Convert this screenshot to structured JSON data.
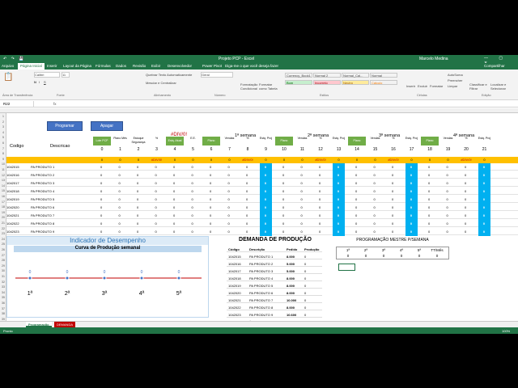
{
  "titlebar": {
    "quick_access": "↶ ↷ 💾",
    "title": "Projeto PCP - Excel",
    "user": "Marcelo Medina",
    "controls": "— ▢ ✕"
  },
  "tabs": [
    "Arquivo",
    "Página Inicial",
    "Inserir",
    "Layout da Página",
    "Fórmulas",
    "Dados",
    "Revisão",
    "Exibir",
    "Desenvolvedor",
    "Power Pivot",
    "Diga-me o que você deseja fazer"
  ],
  "share_label": "Compartilhar",
  "ribbon": {
    "font_name": "Calibri",
    "font_size": "11",
    "wrap_text": "Quebrar Texto Automaticamente",
    "merge": "Mesclar e Centralizar",
    "number_format": "Geral",
    "conditional": "Formatação Condicional",
    "format_table": "Formatar como Tabela",
    "styles": [
      {
        "label": "Currency_Book1",
        "bg": "#ffffff"
      },
      {
        "label": "Normal 2",
        "bg": "#ffffff"
      },
      {
        "label": "Normal_Cal...",
        "bg": "#ffffff"
      },
      {
        "label": "Normal",
        "bg": "#ffffff"
      },
      {
        "label": "Bom",
        "bg": "#c6efce"
      },
      {
        "label": "Incorreto",
        "bg": "#ffc7ce"
      },
      {
        "label": "Neutro",
        "bg": "#ffeb9c"
      },
      {
        "label": "Cálculo",
        "bg": "#f2f2f2"
      }
    ],
    "insert": "Inserir",
    "delete": "Excluir",
    "format": "Formatar",
    "autosum": "AutoSoma",
    "fill": "Preencher",
    "clear": "Limpar",
    "sort": "Classificar e Filtrar",
    "find": "Localizar e Selecionar",
    "groups": [
      "Área de Transferência",
      "Fonte",
      "Alinhamento",
      "Número",
      "Estilos",
      "Células",
      "Edição"
    ]
  },
  "formula_bar": {
    "name_box": "R22",
    "fx": "fx"
  },
  "buttons": {
    "programar": "Programar",
    "apagar": "Apagar"
  },
  "header": {
    "codigo": "Codigo",
    "descricao": "Descricao",
    "div_error": "#DIV/0!",
    "weeks": [
      "1ª semana",
      "2ª semana",
      "3ª semana",
      "4ª semana"
    ],
    "col_numbers": [
      "0",
      "1",
      "2",
      "3",
      "4",
      "5",
      "6",
      "7",
      "8",
      "9",
      "10",
      "11",
      "12",
      "13",
      "14",
      "15",
      "16",
      "17",
      "18",
      "19",
      "20",
      "21"
    ],
    "col_labels": [
      "Lote PCP",
      "Plano Mês",
      "Estoque Segurança",
      "%",
      "Estq. Atual",
      "E.E.",
      "Plano",
      "Vendas",
      "%",
      "Estq. Proj",
      "Plano",
      "Vendas",
      "%",
      "Estq. Proj",
      "Plano",
      "Vendas",
      "%",
      "Estq. Proj",
      "Plano",
      "Vendas",
      "%",
      "Estq. Proj"
    ],
    "orange_values": [
      "0",
      "0",
      "0",
      "#DIV/0!",
      "0",
      "0",
      "0",
      "0",
      "#DIV/0!",
      "0",
      "0",
      "0",
      "#DIV/0!",
      "0",
      "0",
      "0",
      "#DIV/0!",
      "0",
      "0",
      "0",
      "#DIV/0!",
      "0"
    ]
  },
  "rows": [
    {
      "code": "1042015",
      "desc": "PA PRODUTO 1"
    },
    {
      "code": "1042016",
      "desc": "PA PRODUTO 2"
    },
    {
      "code": "1042017",
      "desc": "PA PRODUTO 3"
    },
    {
      "code": "1042018",
      "desc": "PA PRODUTO 4"
    },
    {
      "code": "1042019",
      "desc": "PA PRODUTO 5"
    },
    {
      "code": "1042020",
      "desc": "PA PRODUTO 6"
    },
    {
      "code": "1042021",
      "desc": "PA PRODUTO 7"
    },
    {
      "code": "1042022",
      "desc": "PA PRODUTO 8"
    },
    {
      "code": "1042023",
      "desc": "PA PRODUTO 9"
    }
  ],
  "row_numbers": [
    "1",
    "2",
    "3",
    "4",
    "5",
    "6",
    "7",
    "8",
    "9",
    "10",
    "11",
    "12",
    "13",
    "14",
    "15",
    "16",
    "17",
    "18",
    "19",
    "20",
    "21",
    "22",
    "23",
    "24",
    "25",
    "26",
    "27",
    "28",
    "29",
    "30",
    "31",
    "32",
    "33",
    "34",
    "35",
    "36",
    "37",
    "38",
    "39"
  ],
  "chart": {
    "title": "Indicador de Desempenho",
    "subtitle": "Curva de Produção semanal"
  },
  "chart_data": {
    "type": "line",
    "title": "Curva de Produção semanal",
    "categories": [
      "1ª",
      "2ª",
      "3ª",
      "4ª",
      "5ª"
    ],
    "series": [
      {
        "values": [
          0,
          0,
          0,
          0,
          0
        ]
      }
    ],
    "data_labels": [
      "0",
      "0",
      "0",
      "0",
      "0"
    ],
    "grid": false
  },
  "demand": {
    "title": "DEMANDA DE PRODUÇÃO",
    "headers": [
      "Código",
      "Descrição",
      "Pedido",
      "Produção"
    ],
    "rows": [
      {
        "code": "1042015",
        "desc": "PA PRODUTO 1",
        "pedido": "8.000",
        "prod": "0"
      },
      {
        "code": "1042016",
        "desc": "PA PRODUTO 2",
        "pedido": "5.000",
        "prod": "0"
      },
      {
        "code": "1042017",
        "desc": "PA PRODUTO 3",
        "pedido": "5.000",
        "prod": "0"
      },
      {
        "code": "1042018",
        "desc": "PA PRODUTO 4",
        "pedido": "8.000",
        "prod": "0"
      },
      {
        "code": "1042019",
        "desc": "PA PRODUTO 5",
        "pedido": "8.000",
        "prod": "0"
      },
      {
        "code": "1042020",
        "desc": "PA PRODUTO 6",
        "pedido": "8.000",
        "prod": "0"
      },
      {
        "code": "1042021",
        "desc": "PA PRODUTO 7",
        "pedido": "10.000",
        "prod": "0"
      },
      {
        "code": "1042022",
        "desc": "PA PRODUTO 8",
        "pedido": "8.000",
        "prod": "0"
      },
      {
        "code": "1042023",
        "desc": "PA PRODUTO 9",
        "pedido": "10.600",
        "prod": "0"
      }
    ],
    "total_label": "TT PEDIDO MÊS",
    "total_value": "70.600",
    "total_prod": "0"
  },
  "programacao": {
    "title": "PROGRAMAÇÃO MESTRE P/SEMANA",
    "headers": [
      "1ª",
      "2ª",
      "3ª",
      "4ª",
      "5ª",
      "TT/Mês"
    ],
    "values": [
      "0",
      "0",
      "0",
      "0",
      "0",
      "0"
    ]
  },
  "sheet_tabs": [
    "Programação",
    "DEMANDA"
  ],
  "status": {
    "left": "Pronto",
    "zoom": "100%"
  }
}
